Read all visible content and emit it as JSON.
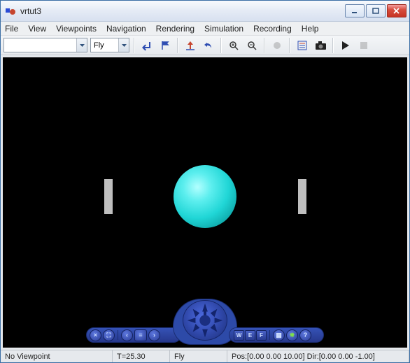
{
  "window": {
    "title": "vrtut3",
    "buttons": {
      "min": "Minimize",
      "max": "Maximize",
      "close": "Close"
    }
  },
  "menu": {
    "items": [
      "File",
      "View",
      "Viewpoints",
      "Navigation",
      "Rendering",
      "Simulation",
      "Recording",
      "Help"
    ]
  },
  "toolbar": {
    "viewpoint_combo": {
      "value": "",
      "placeholder": ""
    },
    "nav_combo": {
      "value": "Fly"
    },
    "buttons": {
      "back": "Back",
      "flag": "Create viewpoint",
      "straighten": "Straighten up",
      "undo": "Undo move",
      "zoomin": "Zoom in",
      "zoomout": "Zoom out",
      "rec": "Record",
      "stop_rec": "Stop",
      "params": "Block parameters",
      "snapshot": "Capture",
      "play": "Start",
      "stop": "Stop"
    }
  },
  "navctrl": {
    "left": {
      "close": "×",
      "home": "⌂",
      "prev": "‹",
      "next": "›"
    },
    "right": {
      "wef": [
        "W",
        "E",
        "F"
      ],
      "wire": "Wireframe",
      "headlight": "Headlight",
      "help": "?"
    }
  },
  "status": {
    "viewpoint": "No Viewpoint",
    "time": "T=25.30",
    "nav": "Fly",
    "pos": "Pos:[0.00 0.00 10.00] Dir:[0.00 0.00 -1.00]"
  }
}
